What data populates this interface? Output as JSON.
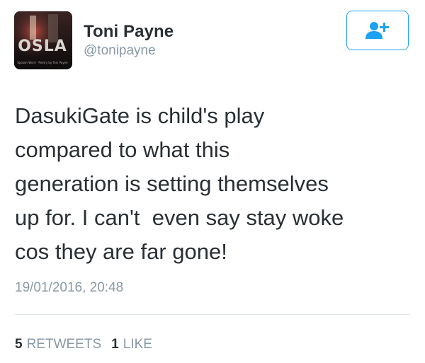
{
  "header": {
    "display_name": "Toni Payne",
    "handle": "@tonipayne",
    "avatar_text": "OSLA",
    "avatar_caption": "Spoken Word · Poetry by Toni Payne",
    "follow_icon": "add-user-icon"
  },
  "tweet": {
    "text": "DasukiGate is child's play\ncompared to what this\ngeneration is setting themselves\nup for. I can't  even say stay woke\ncos they are far gone!",
    "timestamp": "19/01/2016, 20:48"
  },
  "stats": {
    "retweets_count": "5",
    "retweets_label": "RETWEETS",
    "likes_count": "1",
    "likes_label": "LIKE"
  },
  "colors": {
    "accent": "#1da1f2",
    "text": "#292f33",
    "muted": "#8899a6",
    "divider": "#e1e8ed"
  }
}
